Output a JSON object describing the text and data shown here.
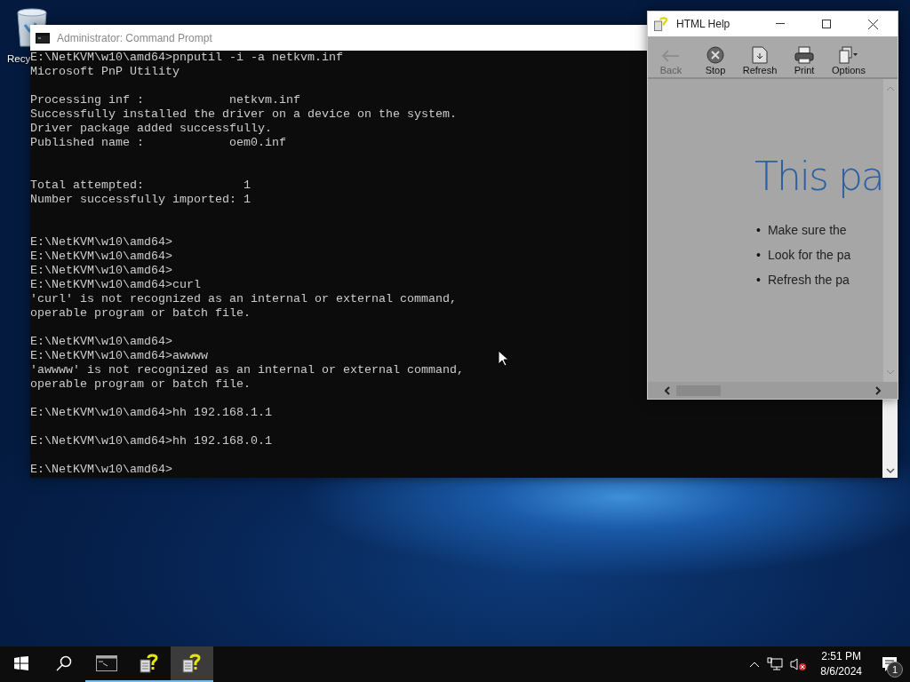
{
  "desktop": {
    "icons": [
      {
        "label": "Recy"
      }
    ]
  },
  "console": {
    "title": "Administrator: Command Prompt",
    "lines": [
      {
        "kind": "text",
        "text": "E:\\NetKVM\\w10\\amd64>pnputil -i -a netkvm.inf"
      },
      {
        "kind": "text",
        "text": "Microsoft PnP Utility"
      },
      {
        "kind": "blank"
      },
      {
        "kind": "text",
        "text": "Processing inf :            netkvm.inf"
      },
      {
        "kind": "text",
        "text": "Successfully installed the driver on a device on the system."
      },
      {
        "kind": "text",
        "text": "Driver package added successfully."
      },
      {
        "kind": "text",
        "text": "Published name :            oem0.inf"
      },
      {
        "kind": "blank"
      },
      {
        "kind": "blank"
      },
      {
        "kind": "text",
        "text": "Total attempted:              1"
      },
      {
        "kind": "text",
        "text": "Number successfully imported: 1"
      },
      {
        "kind": "blank"
      },
      {
        "kind": "blank"
      },
      {
        "kind": "text",
        "text": "E:\\NetKVM\\w10\\amd64>"
      },
      {
        "kind": "text",
        "text": "E:\\NetKVM\\w10\\amd64>"
      },
      {
        "kind": "text",
        "text": "E:\\NetKVM\\w10\\amd64>"
      },
      {
        "kind": "text",
        "text": "E:\\NetKVM\\w10\\amd64>curl"
      },
      {
        "kind": "text",
        "text": "'curl' is not recognized as an internal or external command,"
      },
      {
        "kind": "text",
        "text": "operable program or batch file."
      },
      {
        "kind": "blank"
      },
      {
        "kind": "text",
        "text": "E:\\NetKVM\\w10\\amd64>"
      },
      {
        "kind": "text",
        "text": "E:\\NetKVM\\w10\\amd64>awwww"
      },
      {
        "kind": "text",
        "text": "'awwww' is not recognized as an internal or external command,"
      },
      {
        "kind": "text",
        "text": "operable program or batch file."
      },
      {
        "kind": "blank"
      },
      {
        "kind": "text",
        "text": "E:\\NetKVM\\w10\\amd64>hh 192.168.1.1"
      },
      {
        "kind": "blank"
      },
      {
        "kind": "text",
        "text": "E:\\NetKVM\\w10\\amd64>hh 192.168.0.1"
      },
      {
        "kind": "blank"
      },
      {
        "kind": "text",
        "text": "E:\\NetKVM\\w10\\amd64>"
      }
    ]
  },
  "help": {
    "title": "HTML Help",
    "toolbar": [
      {
        "kind": "back",
        "label": "Back",
        "disabled": true
      },
      {
        "kind": "stop",
        "label": "Stop",
        "disabled": false
      },
      {
        "kind": "refresh",
        "label": "Refresh",
        "disabled": false
      },
      {
        "kind": "print",
        "label": "Print",
        "disabled": false
      },
      {
        "kind": "options",
        "label": "Options",
        "disabled": false
      }
    ],
    "heading": "This pa",
    "bullets": [
      {
        "marker": "•",
        "text": "Make sure the"
      },
      {
        "marker": "•",
        "text": "Look for the pa"
      },
      {
        "marker": "•",
        "text": "Refresh the pa"
      }
    ]
  },
  "taskbar": {
    "apps": [
      {
        "kind": "console",
        "selected": false
      },
      {
        "kind": "help",
        "selected": false
      },
      {
        "kind": "help",
        "selected": true
      }
    ],
    "time": "2:51 PM",
    "date": "8/6/2024",
    "notifications": "1"
  }
}
